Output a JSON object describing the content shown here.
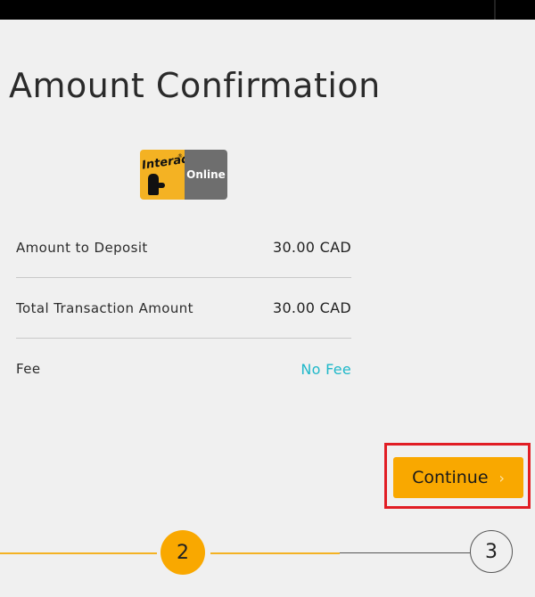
{
  "header": {
    "title": "Amount Confirmation"
  },
  "payment_method": {
    "logo_word": "Interac",
    "logo_mark": "®",
    "logo_label": "Online",
    "icon": "interac-online-logo"
  },
  "summary": {
    "rows": [
      {
        "label": "Amount to Deposit",
        "value": "30.00 CAD"
      },
      {
        "label": "Total Transaction Amount",
        "value": "30.00 CAD"
      },
      {
        "label": "Fee",
        "value": "No Fee"
      }
    ]
  },
  "actions": {
    "continue_label": "Continue",
    "continue_icon": "chevron-right-icon",
    "continue_glyph": "›"
  },
  "stepper": {
    "current_step": "2",
    "next_step": "3"
  },
  "colors": {
    "accent": "#f9a800",
    "fee_text": "#1fb8c9",
    "highlight_border": "#e11d24",
    "background": "#f0f0f0"
  }
}
